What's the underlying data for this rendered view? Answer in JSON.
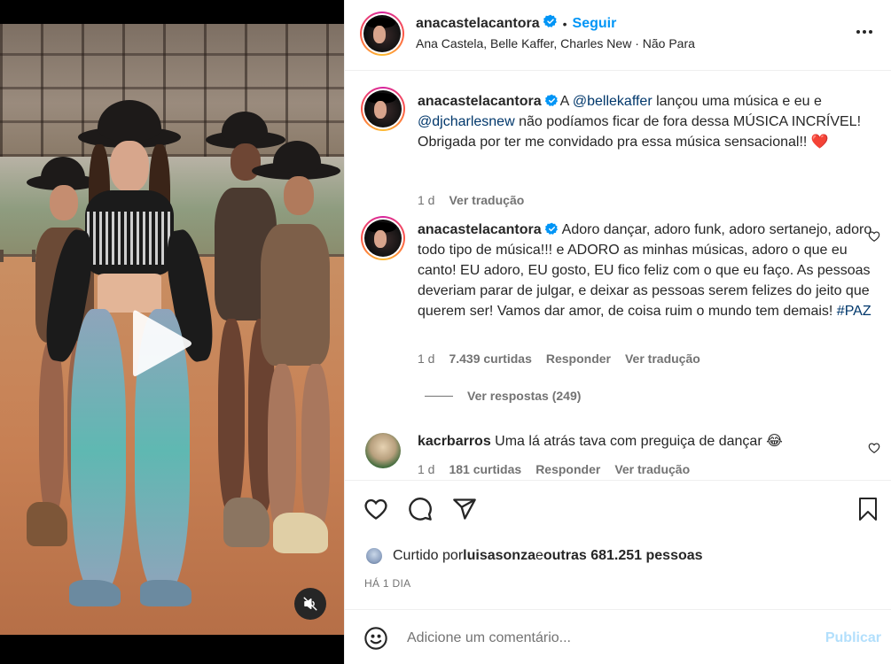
{
  "post": {
    "author": "anacastelacantora",
    "follow_label": "Seguir",
    "separator": "•",
    "audio": "Ana Castela, Belle Kaffer, Charles New · Não Para"
  },
  "caption": {
    "username": "anacastelacantora",
    "text_a": "A ",
    "mention_1": "@bellekaffer",
    "text_b": " lançou uma música e eu e ",
    "mention_2": "@djcharlesnew",
    "text_c": " não podíamos ficar de fora dessa MÚSICA INCRÍVEL! Obrigada por ter me convidado pra essa música sensacional!! ",
    "emoji": "❤️",
    "age": "1 d",
    "translate": "Ver tradução"
  },
  "comments": [
    {
      "username": "anacastelacantora",
      "text": "Adoro dançar, adoro funk, adoro sertanejo, adoro todo tipo de música!!! e ADORO as minhas músicas, adoro o que eu canto! EU adoro, EU gosto, EU fico feliz com o que eu faço. As pessoas deveriam parar de julgar, e deixar as pessoas serem felizes do jeito que querem ser! Vamos dar amor, de coisa ruim o mundo tem demais! ",
      "hashtag": "#PAZ",
      "age": "1 d",
      "likes": "7.439 curtidas",
      "reply": "Responder",
      "translate": "Ver tradução",
      "view_replies": "Ver respostas (249)"
    },
    {
      "username": "kacrbarros",
      "text": "Uma lá atrás tava com preguiça de dançar ",
      "emoji": "😂",
      "age": "1 d",
      "likes": "181 curtidas",
      "reply": "Responder",
      "translate": "Ver tradução"
    }
  ],
  "likes_summary": {
    "prefix": "Curtido por ",
    "user": "luisasonza",
    "middle": " e ",
    "others": "outras 681.251 pessoas"
  },
  "timestamp": "HÁ 1 DIA",
  "add_comment": {
    "placeholder": "Adicione um comentário...",
    "publish": "Publicar"
  },
  "colors": {
    "accent": "#0095f6",
    "mention": "#00376b",
    "muted": "#737373",
    "publish_disabled": "#b2dffc",
    "heart": "#ed4956"
  },
  "icons": [
    "play-icon",
    "mute-icon",
    "verified-icon",
    "more-icon",
    "heart-icon",
    "comment-icon",
    "share-icon",
    "bookmark-icon",
    "emoji-icon"
  ]
}
